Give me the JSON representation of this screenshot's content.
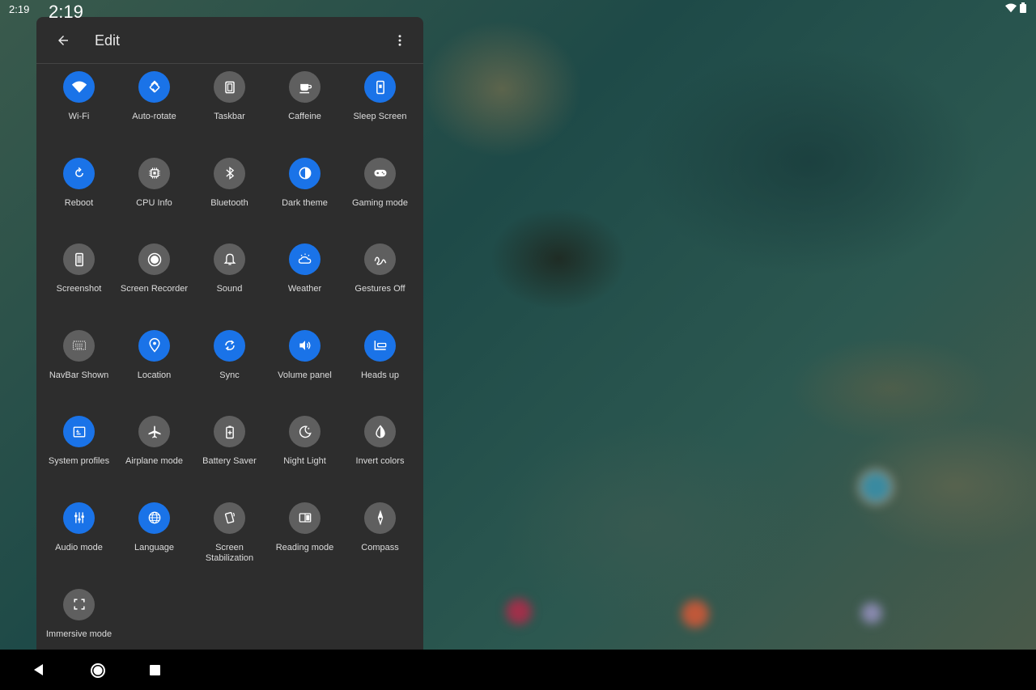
{
  "status_bar": {
    "time": "2:19"
  },
  "panel": {
    "clock": "2:19",
    "toolbar": {
      "title": "Edit"
    },
    "tiles": [
      {
        "label": "Wi-Fi",
        "icon": "wifi-icon",
        "active": true
      },
      {
        "label": "Auto-rotate",
        "icon": "auto-rotate-icon",
        "active": true
      },
      {
        "label": "Taskbar",
        "icon": "taskbar-icon",
        "active": false
      },
      {
        "label": "Caffeine",
        "icon": "caffeine-icon",
        "active": false
      },
      {
        "label": "Sleep Screen",
        "icon": "sleep-screen-icon",
        "active": true
      },
      {
        "label": "Reboot",
        "icon": "reboot-icon",
        "active": true
      },
      {
        "label": "CPU Info",
        "icon": "cpu-icon",
        "active": false
      },
      {
        "label": "Bluetooth",
        "icon": "bluetooth-icon",
        "active": false
      },
      {
        "label": "Dark theme",
        "icon": "dark-theme-icon",
        "active": true
      },
      {
        "label": "Gaming mode",
        "icon": "gamepad-icon",
        "active": false
      },
      {
        "label": "Screenshot",
        "icon": "screenshot-icon",
        "active": false
      },
      {
        "label": "Screen Recorder",
        "icon": "screen-recorder-icon",
        "active": false
      },
      {
        "label": "Sound",
        "icon": "bell-icon",
        "active": false
      },
      {
        "label": "Weather",
        "icon": "weather-icon",
        "active": true
      },
      {
        "label": "Gestures Off",
        "icon": "gesture-icon",
        "active": false
      },
      {
        "label": "NavBar Shown",
        "icon": "keyboard-icon",
        "active": false
      },
      {
        "label": "Location",
        "icon": "location-icon",
        "active": true
      },
      {
        "label": "Sync",
        "icon": "sync-icon",
        "active": true
      },
      {
        "label": "Volume panel",
        "icon": "volume-icon",
        "active": true
      },
      {
        "label": "Heads up",
        "icon": "heads-up-icon",
        "active": true
      },
      {
        "label": "System profiles",
        "icon": "system-profiles-icon",
        "active": true
      },
      {
        "label": "Airplane mode",
        "icon": "airplane-icon",
        "active": false
      },
      {
        "label": "Battery Saver",
        "icon": "battery-saver-icon",
        "active": false
      },
      {
        "label": "Night Light",
        "icon": "night-light-icon",
        "active": false
      },
      {
        "label": "Invert colors",
        "icon": "invert-colors-icon",
        "active": false
      },
      {
        "label": "Audio mode",
        "icon": "audio-mode-icon",
        "active": true
      },
      {
        "label": "Language",
        "icon": "globe-icon",
        "active": true
      },
      {
        "label": "Screen Stabilization",
        "icon": "screen-stabilization-icon",
        "active": false
      },
      {
        "label": "Reading mode",
        "icon": "reading-mode-icon",
        "active": false
      },
      {
        "label": "Compass",
        "icon": "compass-icon",
        "active": false
      },
      {
        "label": "Immersive mode",
        "icon": "immersive-mode-icon",
        "active": false
      }
    ]
  },
  "colors": {
    "active_tile": "#1a73e8",
    "inactive_tile": "#5f5f5f",
    "panel_bg": "#2d2d2d"
  }
}
